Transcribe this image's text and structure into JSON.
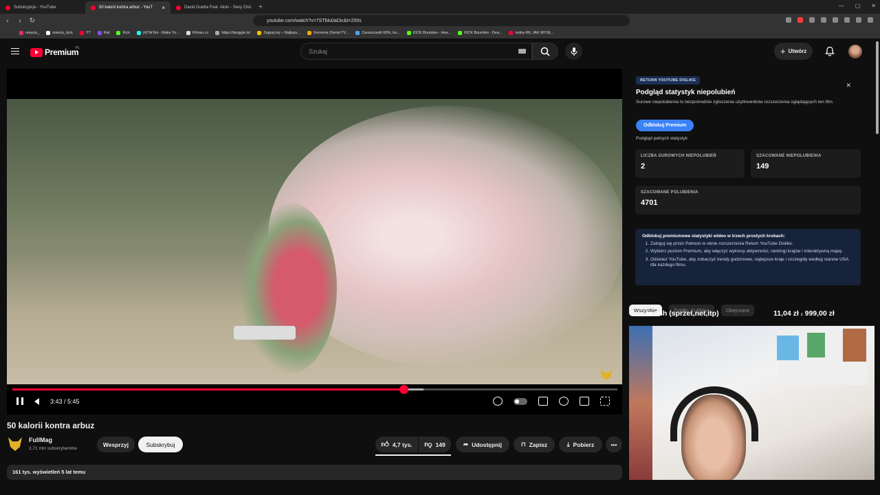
{
  "browser": {
    "tabs": [
      {
        "title": "Subskrypcje - YouTube",
        "active": false
      },
      {
        "title": "50 kalorii kontra arbuz - YouT",
        "active": true
      },
      {
        "title": "David Guetta Feat. Akon - Sexy Chic",
        "active": false
      }
    ],
    "url": "youtube.com/watch?v=7STblu0aDic&t=200s",
    "bookmarks": [
      "nowciu_",
      "nowciu_kick",
      "YT",
      "Rat",
      "Kick",
      "(4)TikTok - Make Yo...",
      "Filman.cc",
      "https://tanggle.io/",
      "Zagraj.my – Najleps...",
      "Gomorra (Serial TV...",
      "Zaoszczędź 60%, ku...",
      "KICK Bounties - Hea...",
      "KICK Bounties - Dea...",
      "nutka IRL JAK WY.IE..."
    ]
  },
  "header": {
    "logo": "Premium",
    "region": "PL",
    "search_placeholder": "Szukaj",
    "create_label": "Utwórz"
  },
  "player": {
    "time": "3:43 / 5:45",
    "progress_fraction": 0.647,
    "buffer_fraction": 0.68
  },
  "video": {
    "title": "50 kalorii kontra arbuz",
    "channel": "FullMag",
    "subscribers": "2,71 mln subskrybentów",
    "support_label": "Wesprzyj",
    "subscribe_label": "Subskrybuj",
    "likes": "4,7 tys.",
    "dislikes": "149",
    "share_label": "Udostępnij",
    "save_label": "Zapisz",
    "download_label": "Pobierz",
    "meta": "161 tys. wyświetleń  5 lat temu"
  },
  "rydpanel": {
    "badge": "RETURN YOUTUBE DISLIKE",
    "title": "Podgląd statystyk niepolubień",
    "description": "Surowe niepolubienia to bezpośrednie zgłoszenia użytkowników rozszerzenia oglądających ten film.",
    "unlock_label": "Odblokuj Premium",
    "full_stats_label": "Podgląd pełnych statystyk",
    "stats": [
      {
        "label": "Liczba surowych niepolubień",
        "value": "2"
      },
      {
        "label": "Szacowane niepolubienia",
        "value": "149"
      },
      {
        "label": "Szacowane polubienia",
        "value": "4701"
      }
    ],
    "steps_title": "Odblokuj premiumowe statystyki wideo w trzech prostych krokach:",
    "steps": [
      "Zaloguj się przez Patreon w oknie rozszerzenia Return YouTube Dislike.",
      "Wybierz poziom Premium, aby włączyć wykresy aktywności, rankingi krajów i interaktywną mapę.",
      "Odśwież YouTube, aby zobaczyć trendy godzinowe, najlepsze kraje i szczegóły według stanów USA dla każdego filmu."
    ]
  },
  "chips": [
    "Wszystkie",
    "Źródło: FullMag",
    "Obejrzane"
  ],
  "overlay": {
    "goal_text": "in 24h (sprzet,net,itp)",
    "current": "11,04 zł",
    "target": "999,00 zł",
    "separator": "z"
  }
}
